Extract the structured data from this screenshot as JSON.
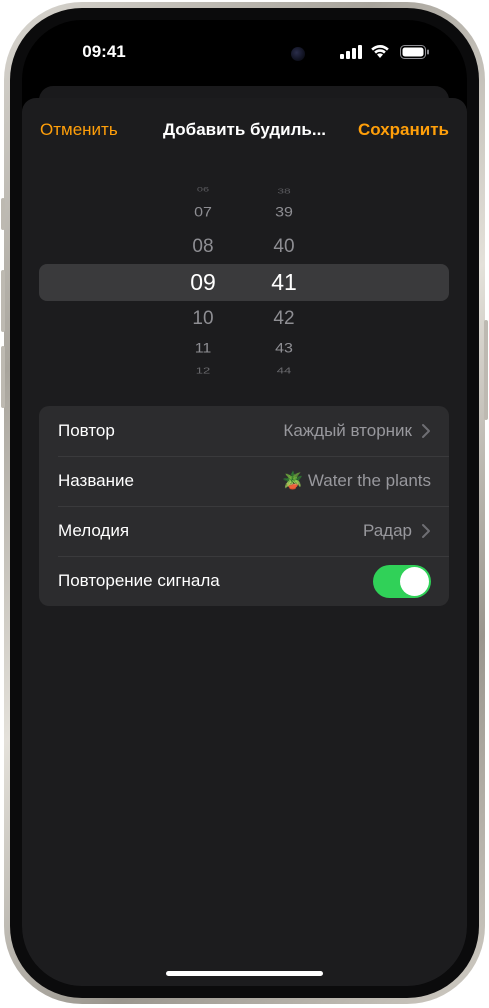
{
  "status": {
    "time": "09:41",
    "icons": [
      "cellular-signal-icon",
      "wifi-icon",
      "battery-icon"
    ]
  },
  "nav": {
    "cancel": "Отменить",
    "title": "Добавить будиль...",
    "save": "Сохранить"
  },
  "picker": {
    "hours": [
      "06",
      "07",
      "08",
      "09",
      "10",
      "11",
      "12"
    ],
    "minutes": [
      "38",
      "39",
      "40",
      "41",
      "42",
      "43",
      "44"
    ],
    "selected_hour": "09",
    "selected_minute": "41"
  },
  "settings": [
    {
      "label": "Повтор",
      "value": "Каждый вторник",
      "chevron": true
    },
    {
      "label": "Название",
      "value": "🪴 Water the plants",
      "chevron": false
    },
    {
      "label": "Мелодия",
      "value": "Радар",
      "chevron": true
    },
    {
      "label": "Повторение сигнала",
      "toggle_on": true
    }
  ],
  "colors": {
    "accent": "#ff9f0a",
    "toggle_on": "#30d158",
    "sheet_bg": "#1c1c1e",
    "group_bg": "#2c2c2e"
  }
}
